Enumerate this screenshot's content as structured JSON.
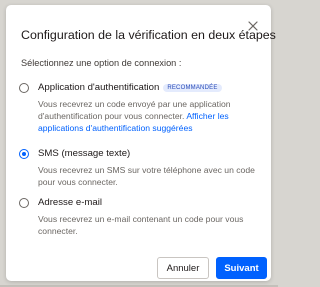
{
  "dialog": {
    "title": "Configuration de la vérification en deux étapes",
    "subtitle": "Sélectionnez une option de connexion :",
    "close_icon": "close-icon"
  },
  "options": [
    {
      "label": "Application d'authentification",
      "badge": "RECOMMANDÉE",
      "description": "Vous recevrez un code envoyé par une application d'authentification pour vous connecter.",
      "link": "Afficher les applications d'authentification suggérées",
      "selected": false
    },
    {
      "label": "SMS (message texte)",
      "description": "Vous recevrez un SMS sur votre téléphone avec un code pour vous connecter.",
      "selected": true
    },
    {
      "label": "Adresse e-mail",
      "description": "Vous recevrez un e-mail contenant un code pour vous connecter.",
      "selected": false
    }
  ],
  "buttons": {
    "cancel": "Annuler",
    "next": "Suivant"
  },
  "colors": {
    "accent": "#0061fe",
    "badge_bg": "#e4ebfd",
    "badge_text": "#2b4db8"
  }
}
